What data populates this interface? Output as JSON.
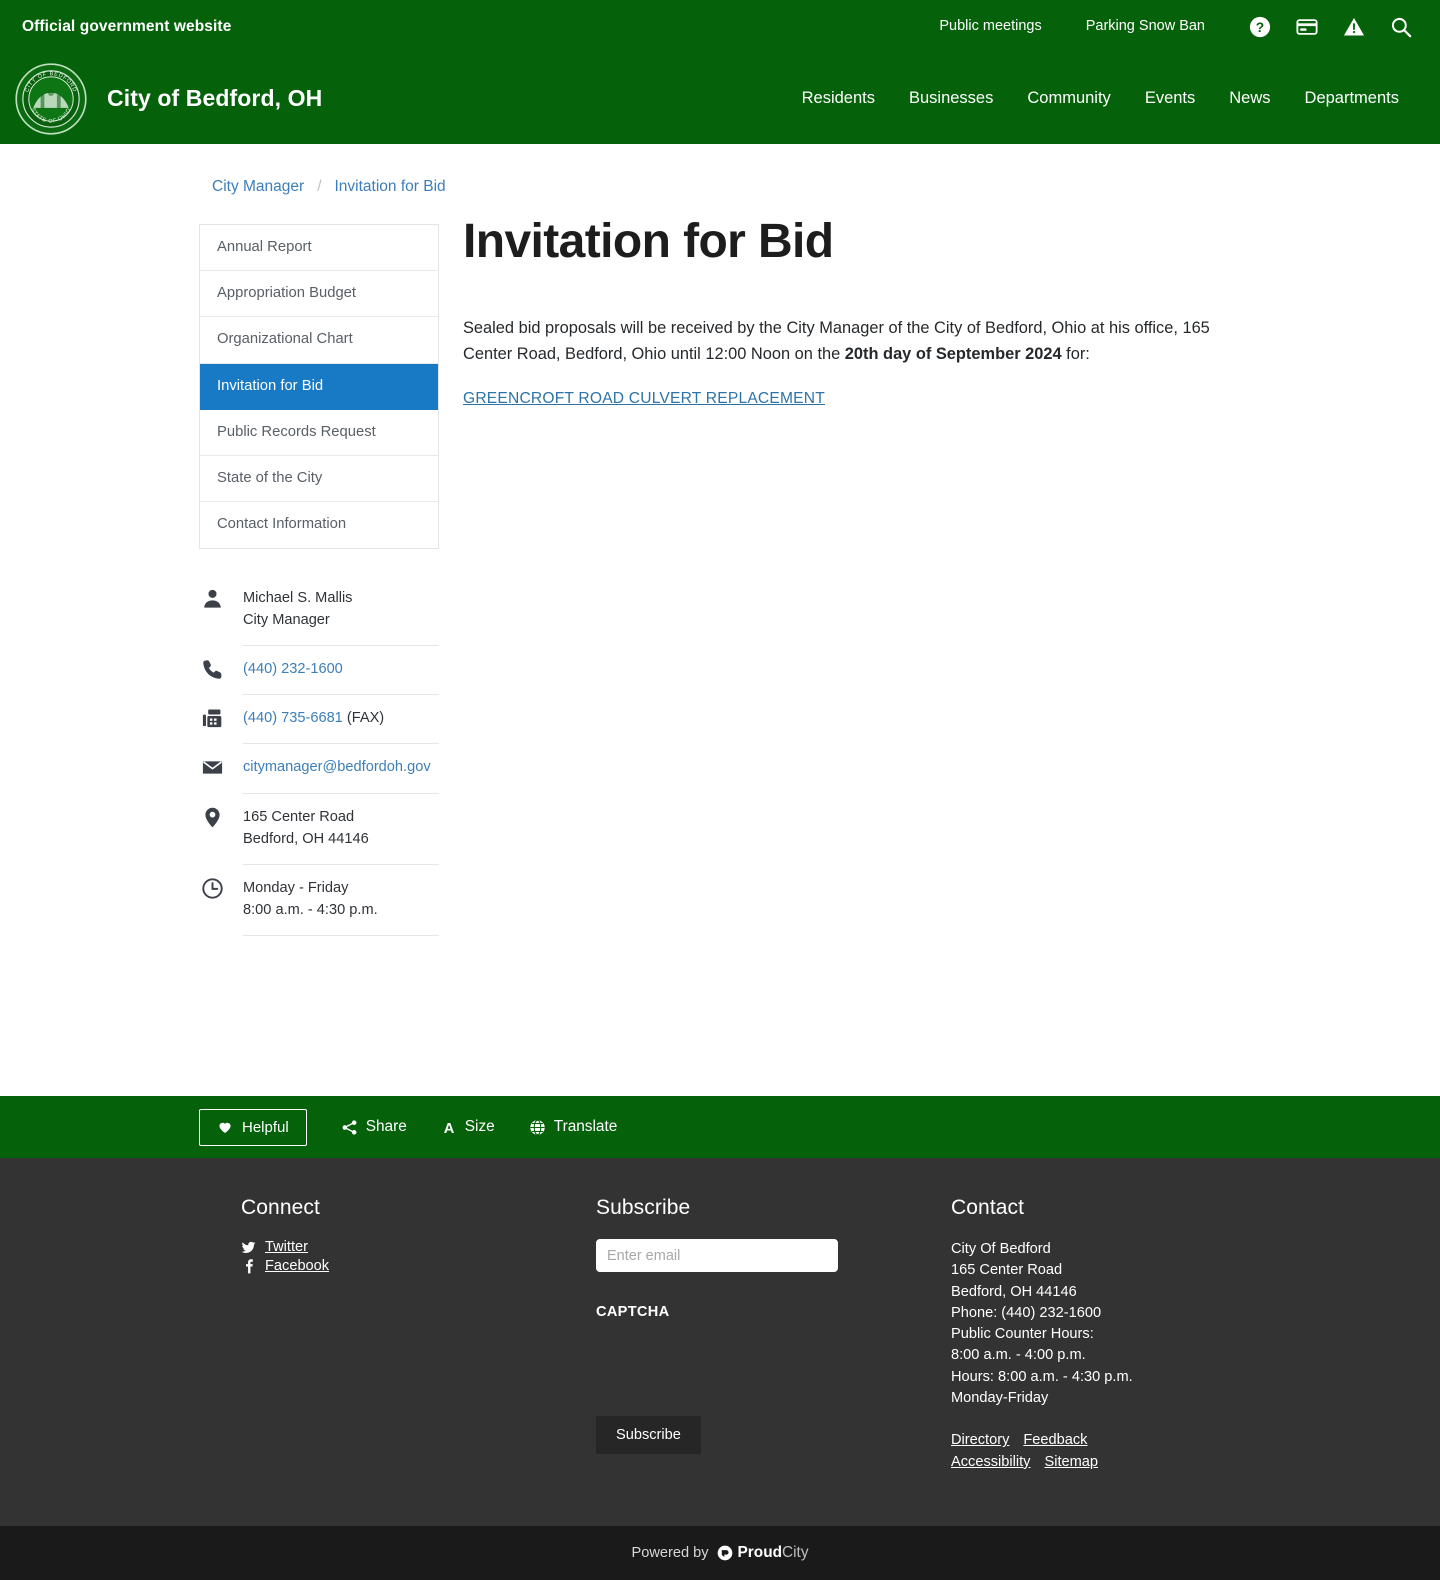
{
  "header": {
    "gov_label": "Official government website",
    "utility_links": [
      "Public meetings",
      "Parking Snow Ban"
    ],
    "utility_icons": [
      "help-icon",
      "payment-card-icon",
      "alert-icon",
      "search-icon"
    ],
    "brand_title": "City of Bedford, OH",
    "seal_text_top": "CITY OF BEDFORD",
    "seal_text_bottom": "STATE OF OHIO",
    "nav": [
      "Residents",
      "Businesses",
      "Community",
      "Events",
      "News",
      "Departments"
    ],
    "bg_color": "#05610a"
  },
  "breadcrumb": {
    "parent": "City Manager",
    "separator": "/",
    "current": "Invitation for Bid"
  },
  "sidebar": {
    "menu": [
      {
        "label": "Annual Report",
        "active": false
      },
      {
        "label": "Appropriation Budget",
        "active": false
      },
      {
        "label": "Organizational Chart",
        "active": false
      },
      {
        "label": "Invitation for Bid",
        "active": true
      },
      {
        "label": "Public Records Request",
        "active": false
      },
      {
        "label": "State of the City",
        "active": false
      },
      {
        "label": "Contact Information",
        "active": false
      }
    ],
    "active_color": "#1879c4",
    "contact": {
      "person_name": "Michael S. Mallis",
      "person_title": "City Manager",
      "phone": "(440) 232-1600",
      "fax": "(440) 735-6681",
      "fax_suffix": " (FAX)",
      "email": "citymanager@bedfordoh.gov",
      "address_line1": "165 Center Road",
      "address_line2": "Bedford, OH 44146",
      "hours_days": "Monday - Friday",
      "hours_time": "8:00 a.m. - 4:30 p.m."
    }
  },
  "main": {
    "title": "Invitation for Bid",
    "paragraph_part1": "Sealed bid proposals will be received by the City Manager of the City of Bedford, Ohio at his office, 165 Center Road, Bedford, Ohio until 12:00 Noon on the ",
    "paragraph_bold": "20th day of September 2024",
    "paragraph_part2": " for:",
    "bid_link": "GREENCROFT ROAD CULVERT REPLACEMENT"
  },
  "action_bar": {
    "helpful": "Helpful",
    "share": "Share",
    "size": "Size",
    "translate": "Translate"
  },
  "footer": {
    "connect_heading": "Connect",
    "social": [
      {
        "label": "Twitter",
        "icon": "twitter-icon"
      },
      {
        "label": "Facebook",
        "icon": "facebook-icon"
      }
    ],
    "subscribe_heading": "Subscribe",
    "email_placeholder": "Enter email",
    "email_value": "",
    "captcha_label": "CAPTCHA",
    "subscribe_button": "Subscribe",
    "contact_heading": "Contact",
    "contact_lines": [
      "City Of Bedford",
      "165 Center Road",
      "Bedford, OH 44146",
      "Phone: (440) 232-1600",
      "Public Counter Hours:",
      "8:00 a.m. - 4:00 p.m.",
      "Hours: 8:00 a.m. - 4:30 p.m.",
      "Monday-Friday"
    ],
    "links": [
      "Directory",
      "Feedback",
      "Accessibility",
      "Sitemap"
    ],
    "powered_by": "Powered by",
    "brand_bold": "Proud",
    "brand_light": "City"
  }
}
